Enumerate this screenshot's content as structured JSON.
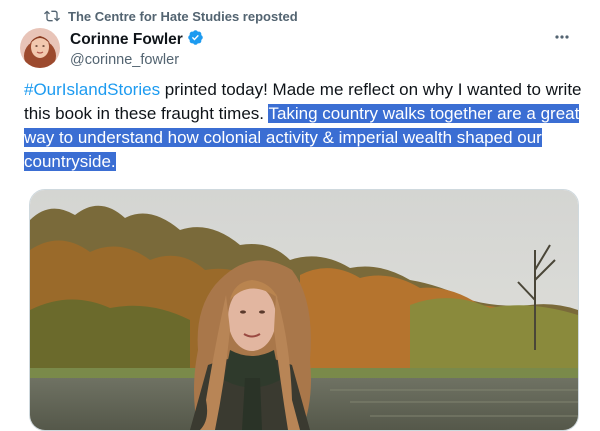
{
  "repost": {
    "text": "The Centre for Hate Studies reposted",
    "icon": "repost-icon"
  },
  "author": {
    "name": "Corinne Fowler",
    "handle": "@corinne_fowler",
    "verified_icon": "verified-badge-icon"
  },
  "more_icon": "more-options-icon",
  "tweet": {
    "hashtag": "#OurIslandStories",
    "text_plain": " printed today! Made me reflect on why I wanted to write this book in these fraught times. ",
    "text_highlighted": "Taking country walks together are a great way to understand how colonial activity & imperial wealth shaped our countryside."
  },
  "colors": {
    "accent": "#1d9bf0",
    "secondary_text": "#536471",
    "selection_highlight": "#3b6ed3"
  }
}
